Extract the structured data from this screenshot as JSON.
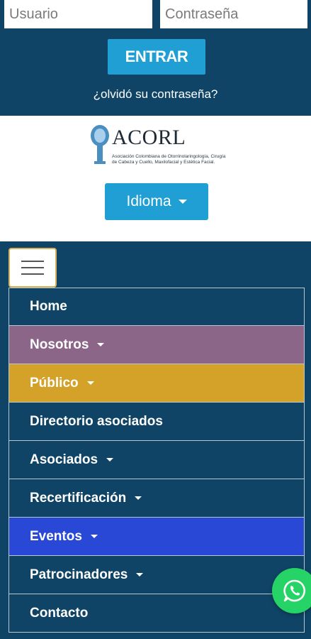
{
  "login": {
    "user_placeholder": "Usuario",
    "password_placeholder": "Contraseña",
    "submit_label": "ENTRAR",
    "forgot_label": "¿olvidó su contraseña?"
  },
  "logo": {
    "title": "ACORL",
    "subtitle": "Asociación Colombiana de Otorrinolaringología, Cirugía de Cabeza y Cuello, Maxilofacial y Estética Facial."
  },
  "language": {
    "label": "Idioma"
  },
  "menu": {
    "items": [
      {
        "label": "Home",
        "dropdown": false,
        "color": "#0f4466"
      },
      {
        "label": "Nosotros",
        "dropdown": true,
        "color": "#8b6689"
      },
      {
        "label": "Público",
        "dropdown": true,
        "color": "#d4a228"
      },
      {
        "label": "Directorio asociados",
        "dropdown": false,
        "color": "#0f4466"
      },
      {
        "label": "Asociados",
        "dropdown": true,
        "color": "#0f4466"
      },
      {
        "label": "Recertificación",
        "dropdown": true,
        "color": "#0f4466"
      },
      {
        "label": "Eventos",
        "dropdown": true,
        "color": "#2a48d6"
      },
      {
        "label": "Patrocinadores",
        "dropdown": true,
        "color": "#0f4466"
      },
      {
        "label": "Contacto",
        "dropdown": false,
        "color": "#0f4466"
      }
    ]
  },
  "colors": {
    "navy": "#0f4466",
    "accent_blue": "#1f9fd3",
    "whatsapp": "#25d366"
  }
}
